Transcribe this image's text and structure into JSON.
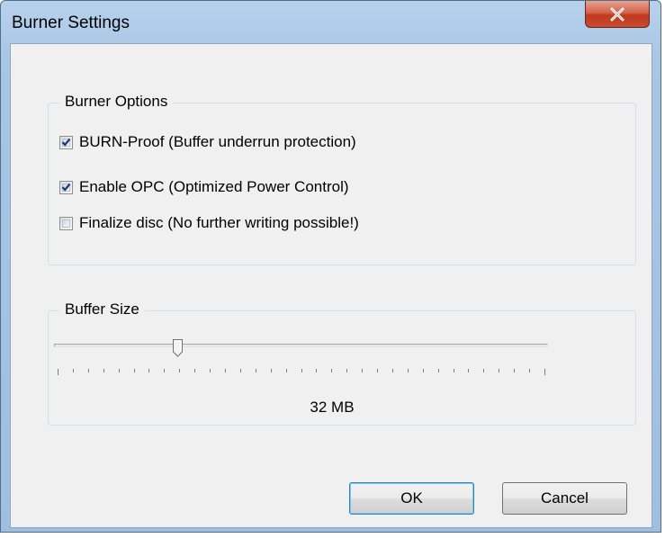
{
  "window": {
    "title": "Burner Settings",
    "close_icon": "close-x-icon"
  },
  "burner_options": {
    "title": "Burner Options",
    "options": [
      {
        "label": "BURN-Proof (Buffer underrun protection)",
        "checked": true
      },
      {
        "label": "Enable OPC (Optimized Power Control)",
        "checked": true
      },
      {
        "label": "Finalize disc (No further writing possible!)",
        "checked": false
      }
    ]
  },
  "buffer_size": {
    "title": "Buffer Size",
    "value_label": "32 MB",
    "slider_fraction": 0.245,
    "tick_count": 32
  },
  "buttons": {
    "ok": "OK",
    "cancel": "Cancel"
  }
}
